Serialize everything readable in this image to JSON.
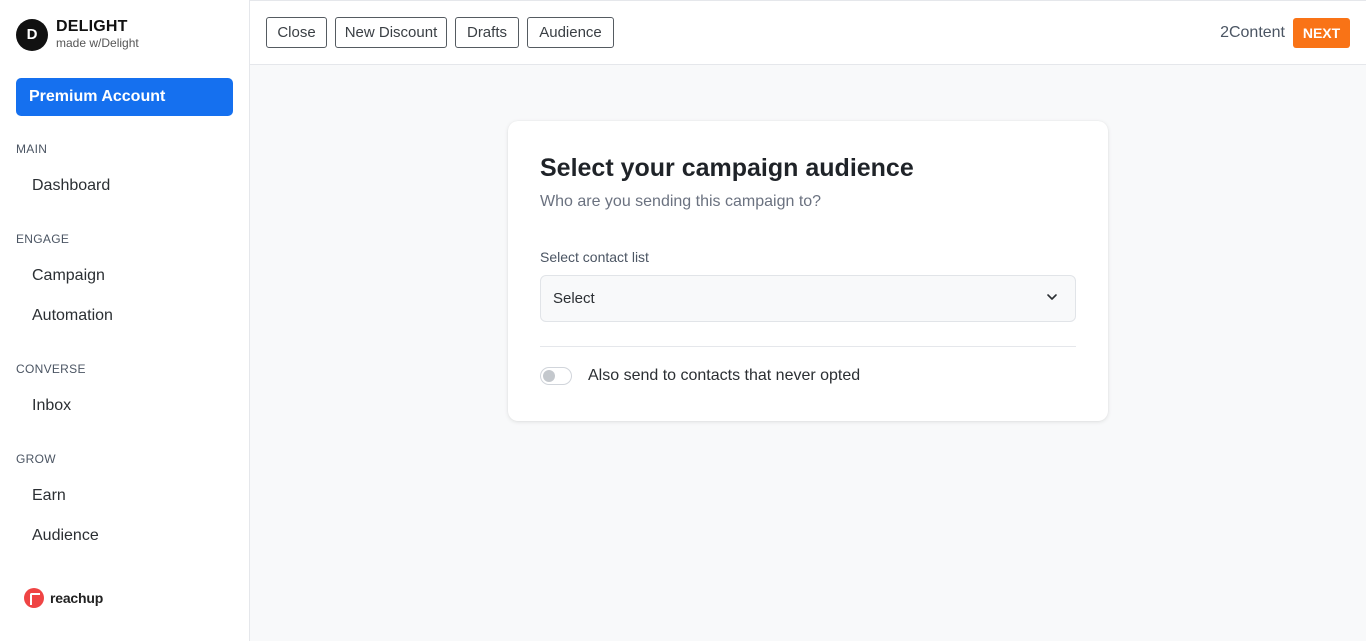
{
  "brand": {
    "initial": "D",
    "name": "DELIGHT",
    "tagline": "made w/Delight"
  },
  "sidebar": {
    "premium_label": "Premium Account",
    "sections": [
      {
        "label": "MAIN",
        "items": [
          {
            "label": "Dashboard"
          }
        ]
      },
      {
        "label": "ENGAGE",
        "items": [
          {
            "label": "Campaign"
          },
          {
            "label": "Automation"
          }
        ]
      },
      {
        "label": "CONVERSE",
        "items": [
          {
            "label": "Inbox"
          }
        ]
      },
      {
        "label": "GROW",
        "items": [
          {
            "label": "Earn"
          },
          {
            "label": "Audience"
          }
        ]
      }
    ],
    "footer_logo_text": "reachup"
  },
  "toolbar": {
    "buttons": [
      {
        "label": "Close"
      },
      {
        "label": "New Discount"
      },
      {
        "label": "Drafts"
      },
      {
        "label": "Audience"
      }
    ],
    "step_label": "2Content",
    "next_label": "NEXT",
    "next_color": "#f97316"
  },
  "card": {
    "title": "Select your campaign audience",
    "subtitle": "Who are you sending this campaign to?",
    "field_label": "Select contact list",
    "select_value": "Select",
    "toggle_label": "Also send to contacts that never opted",
    "toggle_on": false
  },
  "colors": {
    "accent": "#1570ef",
    "next": "#f97316"
  }
}
